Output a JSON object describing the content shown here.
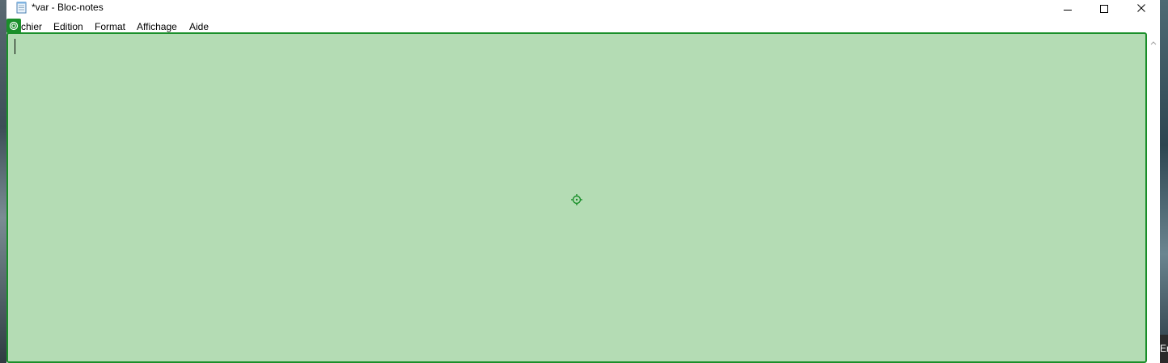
{
  "window": {
    "title": "*var - Bloc-notes"
  },
  "menu": {
    "fichier": "chier",
    "edition": "Edition",
    "format": "Format",
    "affichage": "Affichage",
    "aide": "Aide"
  },
  "taskbar": {
    "peek_text": "Er"
  },
  "editor": {
    "content": ""
  },
  "colors": {
    "highlight_fill": "#b4dcb4",
    "highlight_border": "#1a8f2a"
  },
  "icons": {
    "app": "notepad-icon",
    "minimize": "minimize-icon",
    "maximize": "maximize-icon",
    "close": "close-icon",
    "badge": "target-badge-icon",
    "crosshair": "crosshair-icon",
    "scroll_up": "chevron-up-icon"
  }
}
